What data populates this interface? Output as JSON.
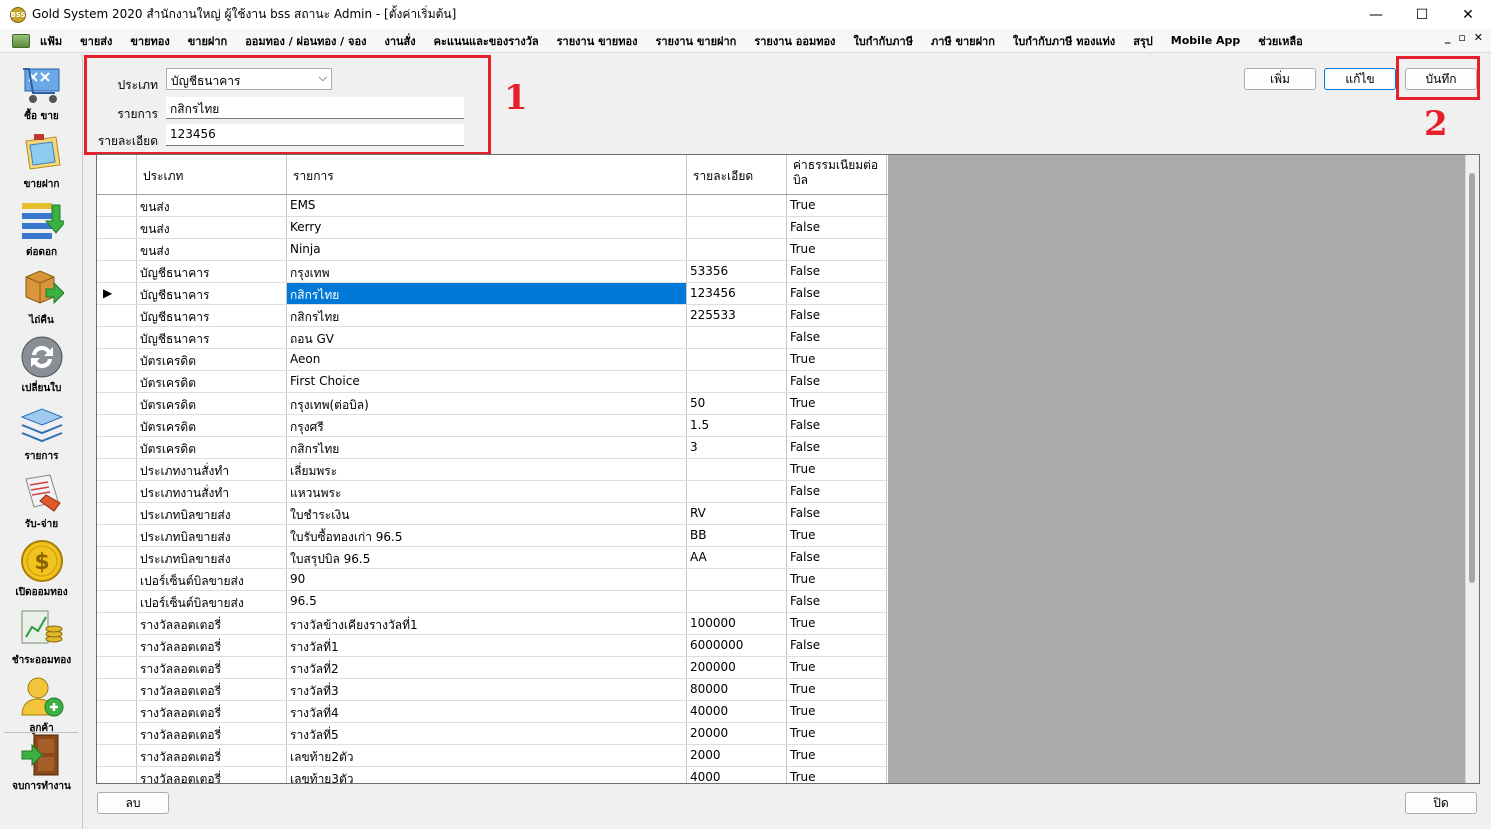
{
  "window": {
    "title": "Gold System 2020  สำนักงานใหญ่ ผู้ใช้งาน bss สถานะ Admin - [ตั้งค่าเริ่มต้น]",
    "logo_text": "BSS",
    "controls": [
      "—",
      "☐",
      "✕"
    ]
  },
  "menu": {
    "items": [
      "แฟ้ม",
      "ขายส่ง",
      "ขายทอง",
      "ขายฝาก",
      "ออมทอง / ผ่อนทอง / จอง",
      "งานสั่ง",
      "คะแนนและของรางวัล",
      "รายงาน ขายทอง",
      "รายงาน ขายฝาก",
      "รายงาน ออมทอง",
      "ใบกำกับภาษี",
      "ภาษี ขายฝาก",
      "ใบกำกับภาษี ทองแท่ง",
      "สรุป",
      "Mobile App",
      "ช่วยเหลือ"
    ],
    "mdi_controls": [
      "_",
      "▫",
      "✕"
    ]
  },
  "toolbar": [
    {
      "label": "ซื้อ ขาย",
      "icon": "buy-sell-icon"
    },
    {
      "label": "ขายฝาก",
      "icon": "consign-icon"
    },
    {
      "label": "ต่อดอก",
      "icon": "interest-icon"
    },
    {
      "label": "ไถ่คืน",
      "icon": "redeem-icon"
    },
    {
      "label": "เปลี่ยนใบ",
      "icon": "exchange-icon"
    },
    {
      "label": "รายการ",
      "icon": "list-icon"
    },
    {
      "label": "รับ-จ่าย",
      "icon": "receive-pay-icon"
    },
    {
      "label": "เปิดออมทอง",
      "icon": "open-savings-icon"
    },
    {
      "label": "ชำระออมทอง",
      "icon": "pay-savings-icon"
    },
    {
      "label": "ลูกค้า",
      "icon": "customer-icon"
    },
    {
      "label": "จบการทำงาน",
      "icon": "exit-icon"
    }
  ],
  "form": {
    "type_label": "ประเภท",
    "type_value": "บัญชีธนาคาร",
    "item_label": "รายการ",
    "item_value": "กสิกรไทย",
    "detail_label": "รายละเอียด",
    "detail_value": "123456"
  },
  "buttons": {
    "add": "เพิ่ม",
    "edit": "แก้ไข",
    "save": "บันทึก",
    "delete": "ลบ",
    "close": "ปิด"
  },
  "annotations": {
    "box1": "1",
    "box2": "2",
    "color": "#e6202a"
  },
  "grid": {
    "headers": [
      "ประเภท",
      "รายการ",
      "รายละเอียด",
      "ค่าธรรมเนียมต่อบิล"
    ],
    "selected_row": 4,
    "rows": [
      [
        "ขนส่ง",
        "EMS",
        "",
        "True"
      ],
      [
        "ขนส่ง",
        "Kerry",
        "",
        "False"
      ],
      [
        "ขนส่ง",
        "Ninja",
        "",
        "True"
      ],
      [
        "บัญชีธนาคาร",
        "กรุงเทพ",
        "53356",
        "False"
      ],
      [
        "บัญชีธนาคาร",
        "กสิกรไทย",
        "123456",
        "False"
      ],
      [
        "บัญชีธนาคาร",
        "กสิกรไทย",
        "225533",
        "False"
      ],
      [
        "บัญชีธนาคาร",
        "ถอน GV",
        "",
        "False"
      ],
      [
        "บัตรเครดิต",
        "Aeon",
        "",
        "True"
      ],
      [
        "บัตรเครดิต",
        "First Choice",
        "",
        "False"
      ],
      [
        "บัตรเครดิต",
        "กรุงเทพ(ต่อบิล)",
        "50",
        "True"
      ],
      [
        "บัตรเครดิต",
        "กรุงศรี",
        "1.5",
        "False"
      ],
      [
        "บัตรเครดิต",
        "กสิกรไทย",
        "3",
        "False"
      ],
      [
        "ประเภทงานสั่งทำ",
        "เลี่ยมพระ",
        "",
        "True"
      ],
      [
        "ประเภทงานสั่งทำ",
        "แหวนพระ",
        "",
        "False"
      ],
      [
        "ประเภทบิลขายส่ง",
        "ใบชำระเงิน",
        "RV",
        "False"
      ],
      [
        "ประเภทบิลขายส่ง",
        "ใบรับซื้อทองเก่า 96.5",
        "BB",
        "True"
      ],
      [
        "ประเภทบิลขายส่ง",
        "ใบสรุปบิล 96.5",
        "AA",
        "False"
      ],
      [
        "เปอร์เซ็นต์บิลขายส่ง",
        "90",
        "",
        "True"
      ],
      [
        "เปอร์เซ็นต์บิลขายส่ง",
        "96.5",
        "",
        "False"
      ],
      [
        "รางวัลลอตเตอรี่",
        "รางวัลข้างเคียงรางวัลที่1",
        "100000",
        "True"
      ],
      [
        "รางวัลลอตเตอรี่",
        "รางวัลที่1",
        "6000000",
        "False"
      ],
      [
        "รางวัลลอตเตอรี่",
        "รางวัลที่2",
        "200000",
        "True"
      ],
      [
        "รางวัลลอตเตอรี่",
        "รางวัลที่3",
        "80000",
        "True"
      ],
      [
        "รางวัลลอตเตอรี่",
        "รางวัลที่4",
        "40000",
        "True"
      ],
      [
        "รางวัลลอตเตอรี่",
        "รางวัลที่5",
        "20000",
        "True"
      ],
      [
        "รางวัลลอตเตอรี่",
        "เลขท้าย2ตัว",
        "2000",
        "True"
      ],
      [
        "รางวัลลอตเตอรี่",
        "เลขท้าย3ตัว",
        "4000",
        "True"
      ]
    ]
  }
}
